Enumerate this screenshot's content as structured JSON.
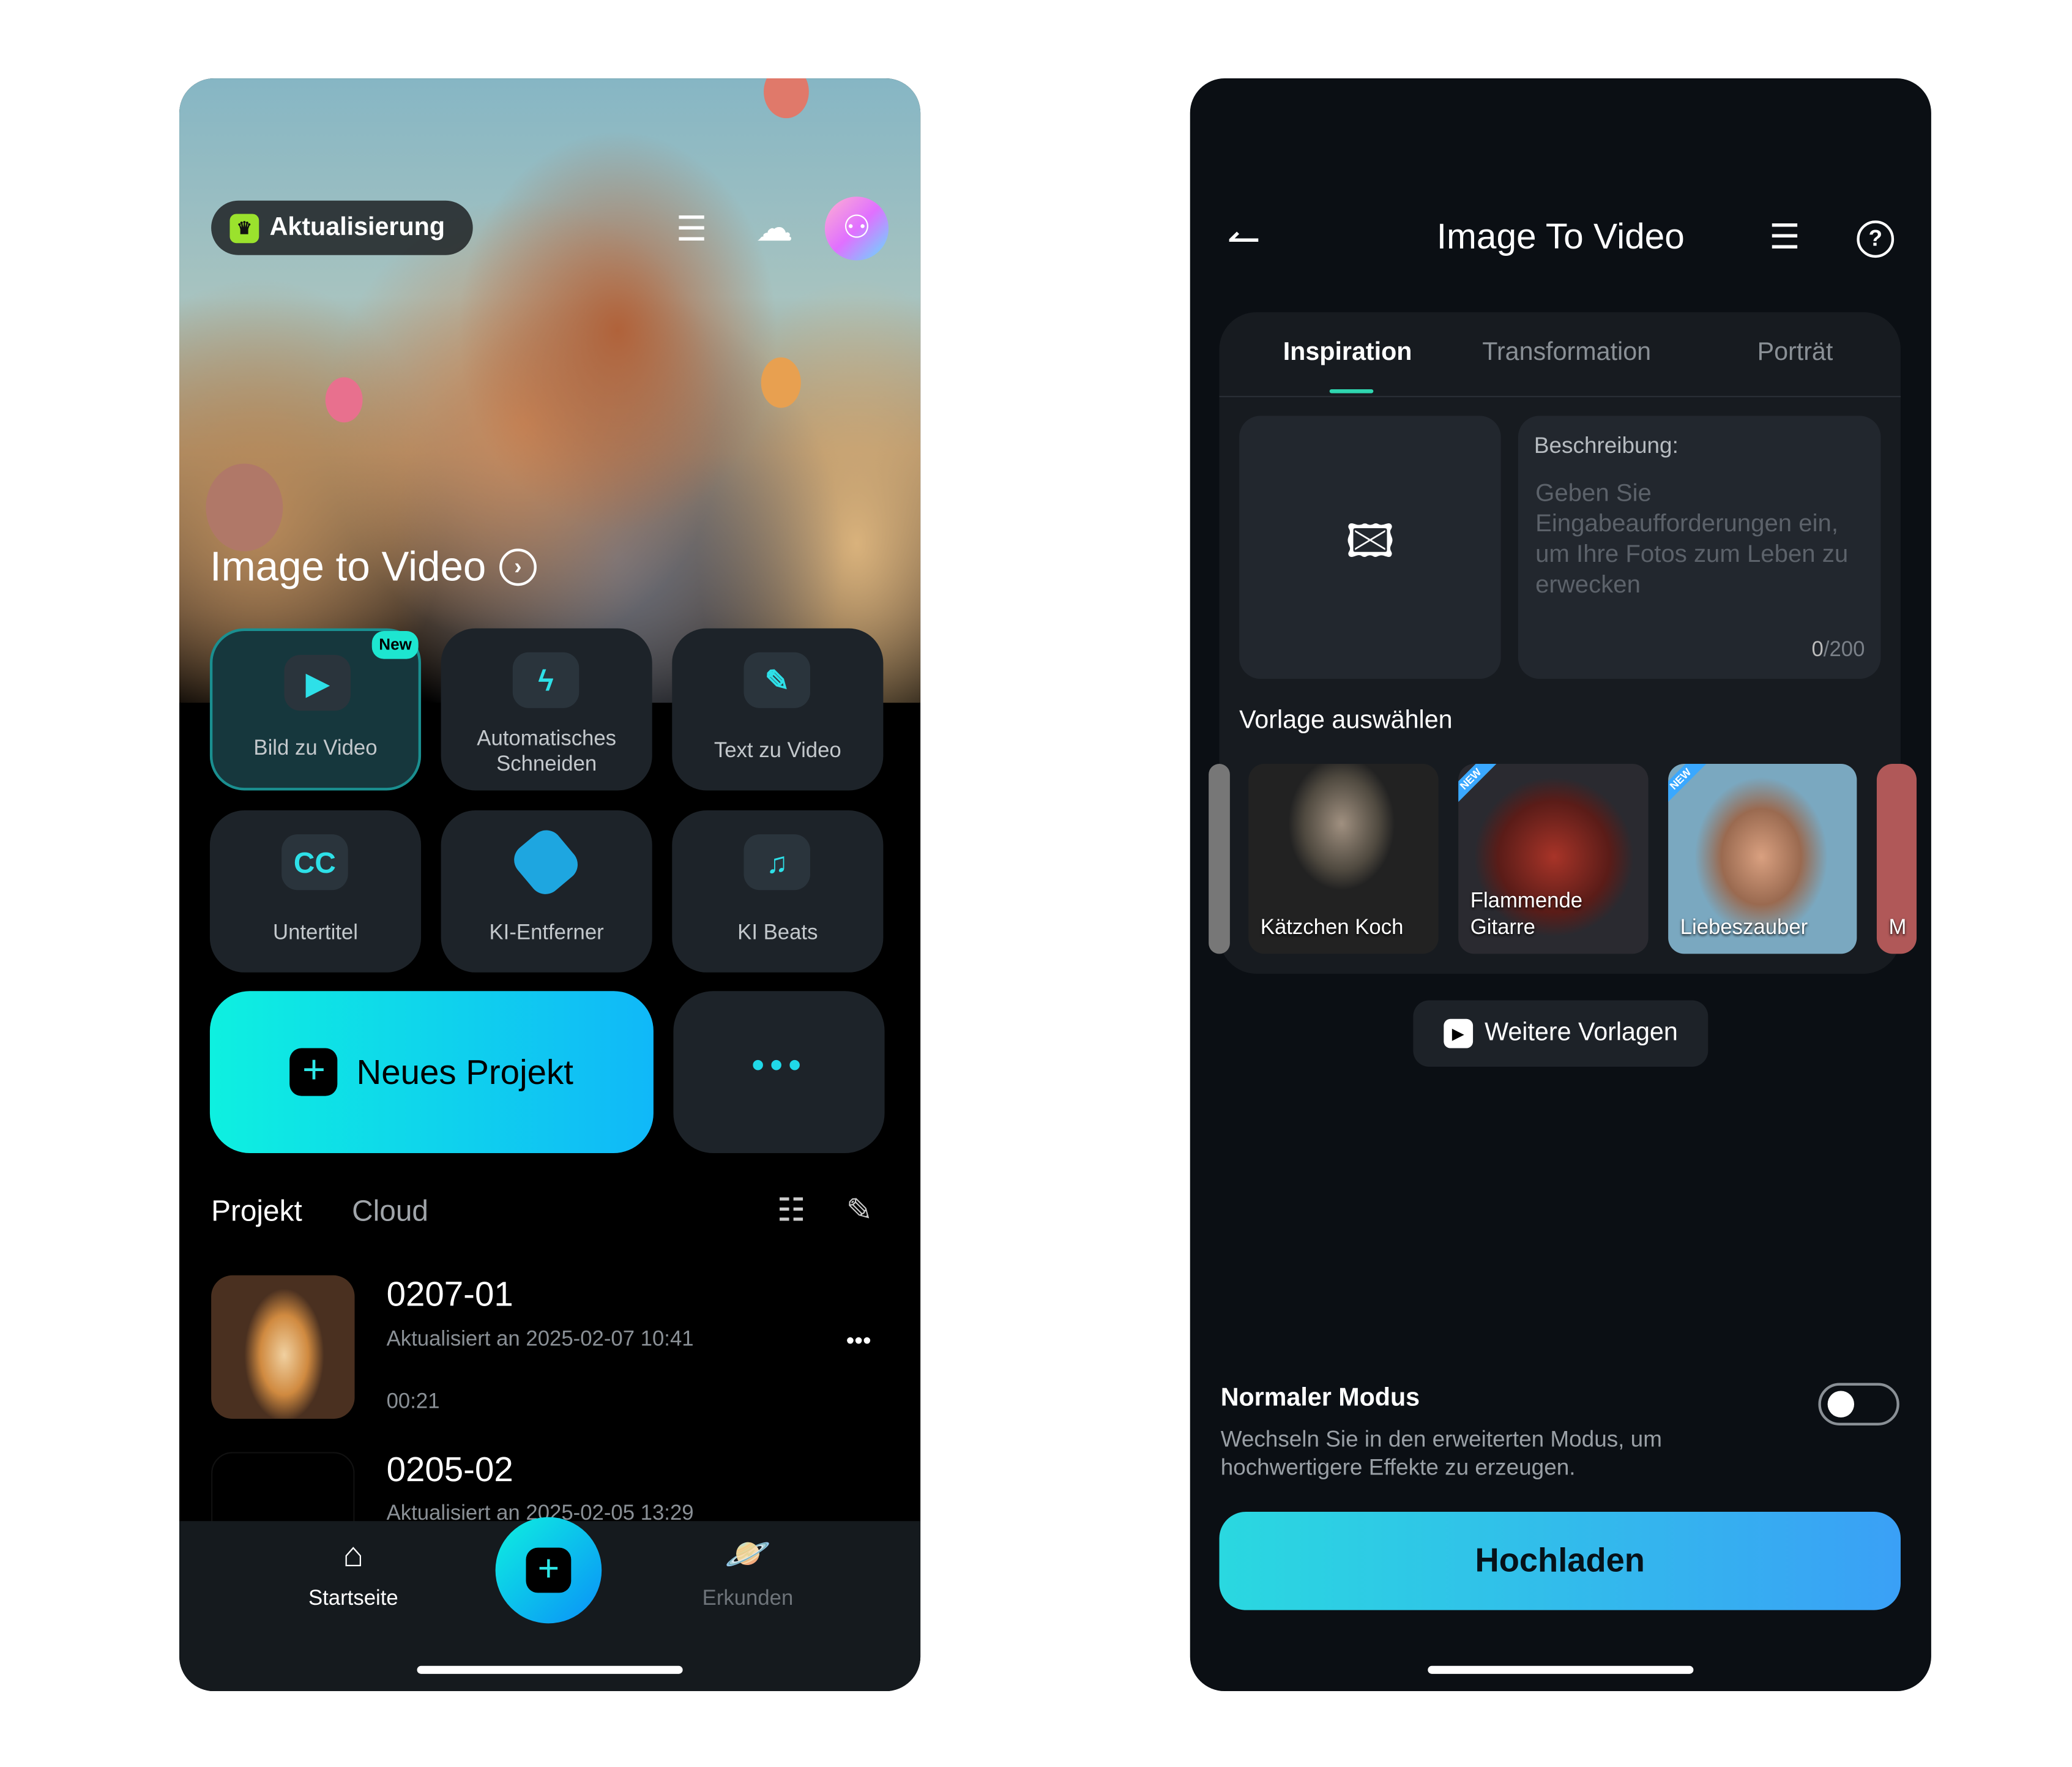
{
  "home": {
    "update_badge": "Aktualisierung",
    "hero_title": "Image to Video",
    "tools": [
      {
        "label": "Bild zu Video",
        "badge": "New",
        "icon": "image-video-icon"
      },
      {
        "label": "Automatisches Schneiden",
        "icon": "lightning-icon"
      },
      {
        "label": "Text  zu Video",
        "icon": "pencil-icon"
      },
      {
        "label": "Untertitel",
        "icon": "cc-icon"
      },
      {
        "label": "KI-Entferner",
        "icon": "eraser-icon"
      },
      {
        "label": "KI Beats",
        "icon": "music-beats-icon"
      }
    ],
    "new_project": "Neues Projekt",
    "tabs": {
      "project": "Projekt",
      "cloud": "Cloud"
    },
    "projects": [
      {
        "title": "0207-01",
        "updated": "Aktualisiert an 2025-02-07 10:41",
        "duration": "00:21"
      },
      {
        "title": "0205-02",
        "updated": "Aktualisiert an 2025-02-05 13:29"
      }
    ],
    "nav": {
      "home": "Startseite",
      "explore": "Erkunden"
    },
    "accent": "#1de6e0"
  },
  "i2v": {
    "title": "Image To Video",
    "tabs": [
      "Inspiration",
      "Transformation",
      "Porträt"
    ],
    "active_tab": "Inspiration",
    "description_label": "Beschreibung:",
    "description_placeholder": "Geben Sie Eingabeaufforderungen ein, um Ihre Fotos zum Leben zu erwecken",
    "counter_current": "0",
    "counter_max": "/200",
    "template_heading": "Vorlage auswählen",
    "templates": [
      {
        "name": "Kätzchen Koch",
        "new": false
      },
      {
        "name": "Flammende Gitarre",
        "new": true,
        "badge": "NEW"
      },
      {
        "name": "Liebeszauber",
        "new": true,
        "badge": "NEW"
      },
      {
        "name": "M"
      }
    ],
    "more_templates": "Weitere Vorlagen",
    "mode_title": "Normaler Modus",
    "mode_desc": "Wechseln Sie in den erweiterten Modus, um hochwertigere Effekte zu erzeugen.",
    "mode_enabled": false,
    "upload": "Hochladen"
  }
}
